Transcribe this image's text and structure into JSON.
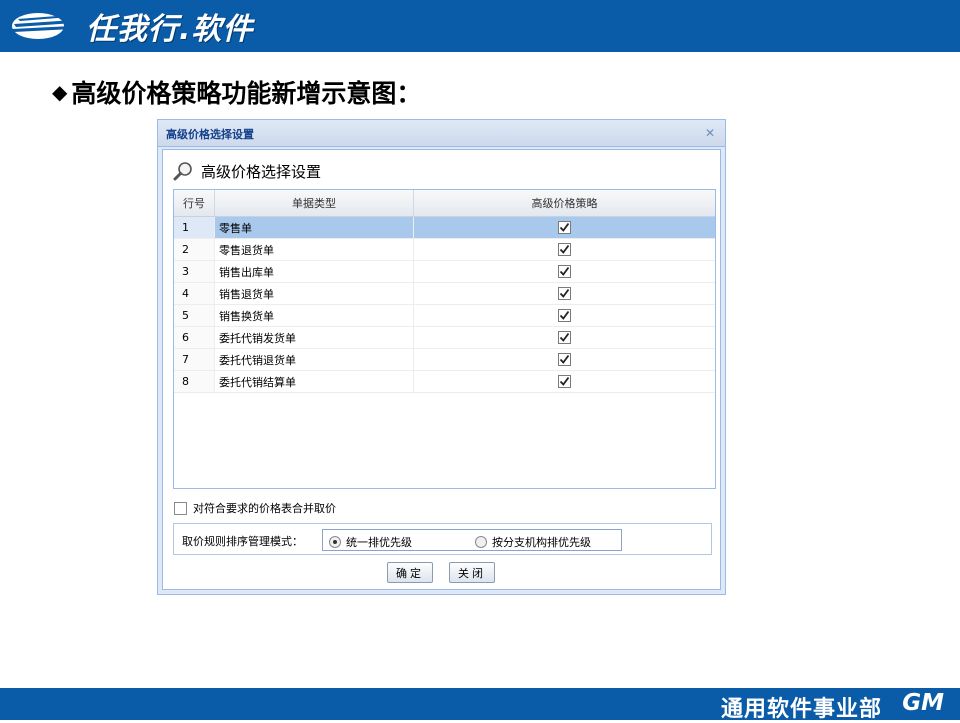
{
  "brand": {
    "logo_text": "任我行.软件"
  },
  "slide": {
    "heading": "高级价格策略功能新增示意图：",
    "bullet": "◆"
  },
  "dialog": {
    "title": "高级价格选择设置",
    "close": "✕",
    "panel_title": "高级价格选择设置",
    "grid": {
      "columns": [
        "行号",
        "单据类型",
        "高级价格策略"
      ],
      "rows": [
        {
          "no": "1",
          "type": "零售单",
          "checked": true,
          "selected": true
        },
        {
          "no": "2",
          "type": "零售退货单",
          "checked": true
        },
        {
          "no": "3",
          "type": "销售出库单",
          "checked": true
        },
        {
          "no": "4",
          "type": "销售退货单",
          "checked": true
        },
        {
          "no": "5",
          "type": "销售换货单",
          "checked": true
        },
        {
          "no": "6",
          "type": "委托代销发货单",
          "checked": true
        },
        {
          "no": "7",
          "type": "委托代销退货单",
          "checked": true
        },
        {
          "no": "8",
          "type": "委托代销结算单",
          "checked": true
        }
      ]
    },
    "merge_option": {
      "label": "对符合要求的价格表合并取价",
      "checked": false
    },
    "mode": {
      "label": "取价规则排序管理模式：",
      "options": [
        {
          "label": "统一排优先级",
          "selected": true
        },
        {
          "label": "按分支机构排优先级",
          "selected": false
        }
      ]
    },
    "buttons": {
      "ok": "确定",
      "close": "关闭"
    }
  },
  "footer": {
    "text": "通用软件事业部",
    "logo": "GM"
  },
  "colors": {
    "banner": "#0a5ca8",
    "selection": "#a8c8ec",
    "dialog_border": "#99bbe8"
  }
}
